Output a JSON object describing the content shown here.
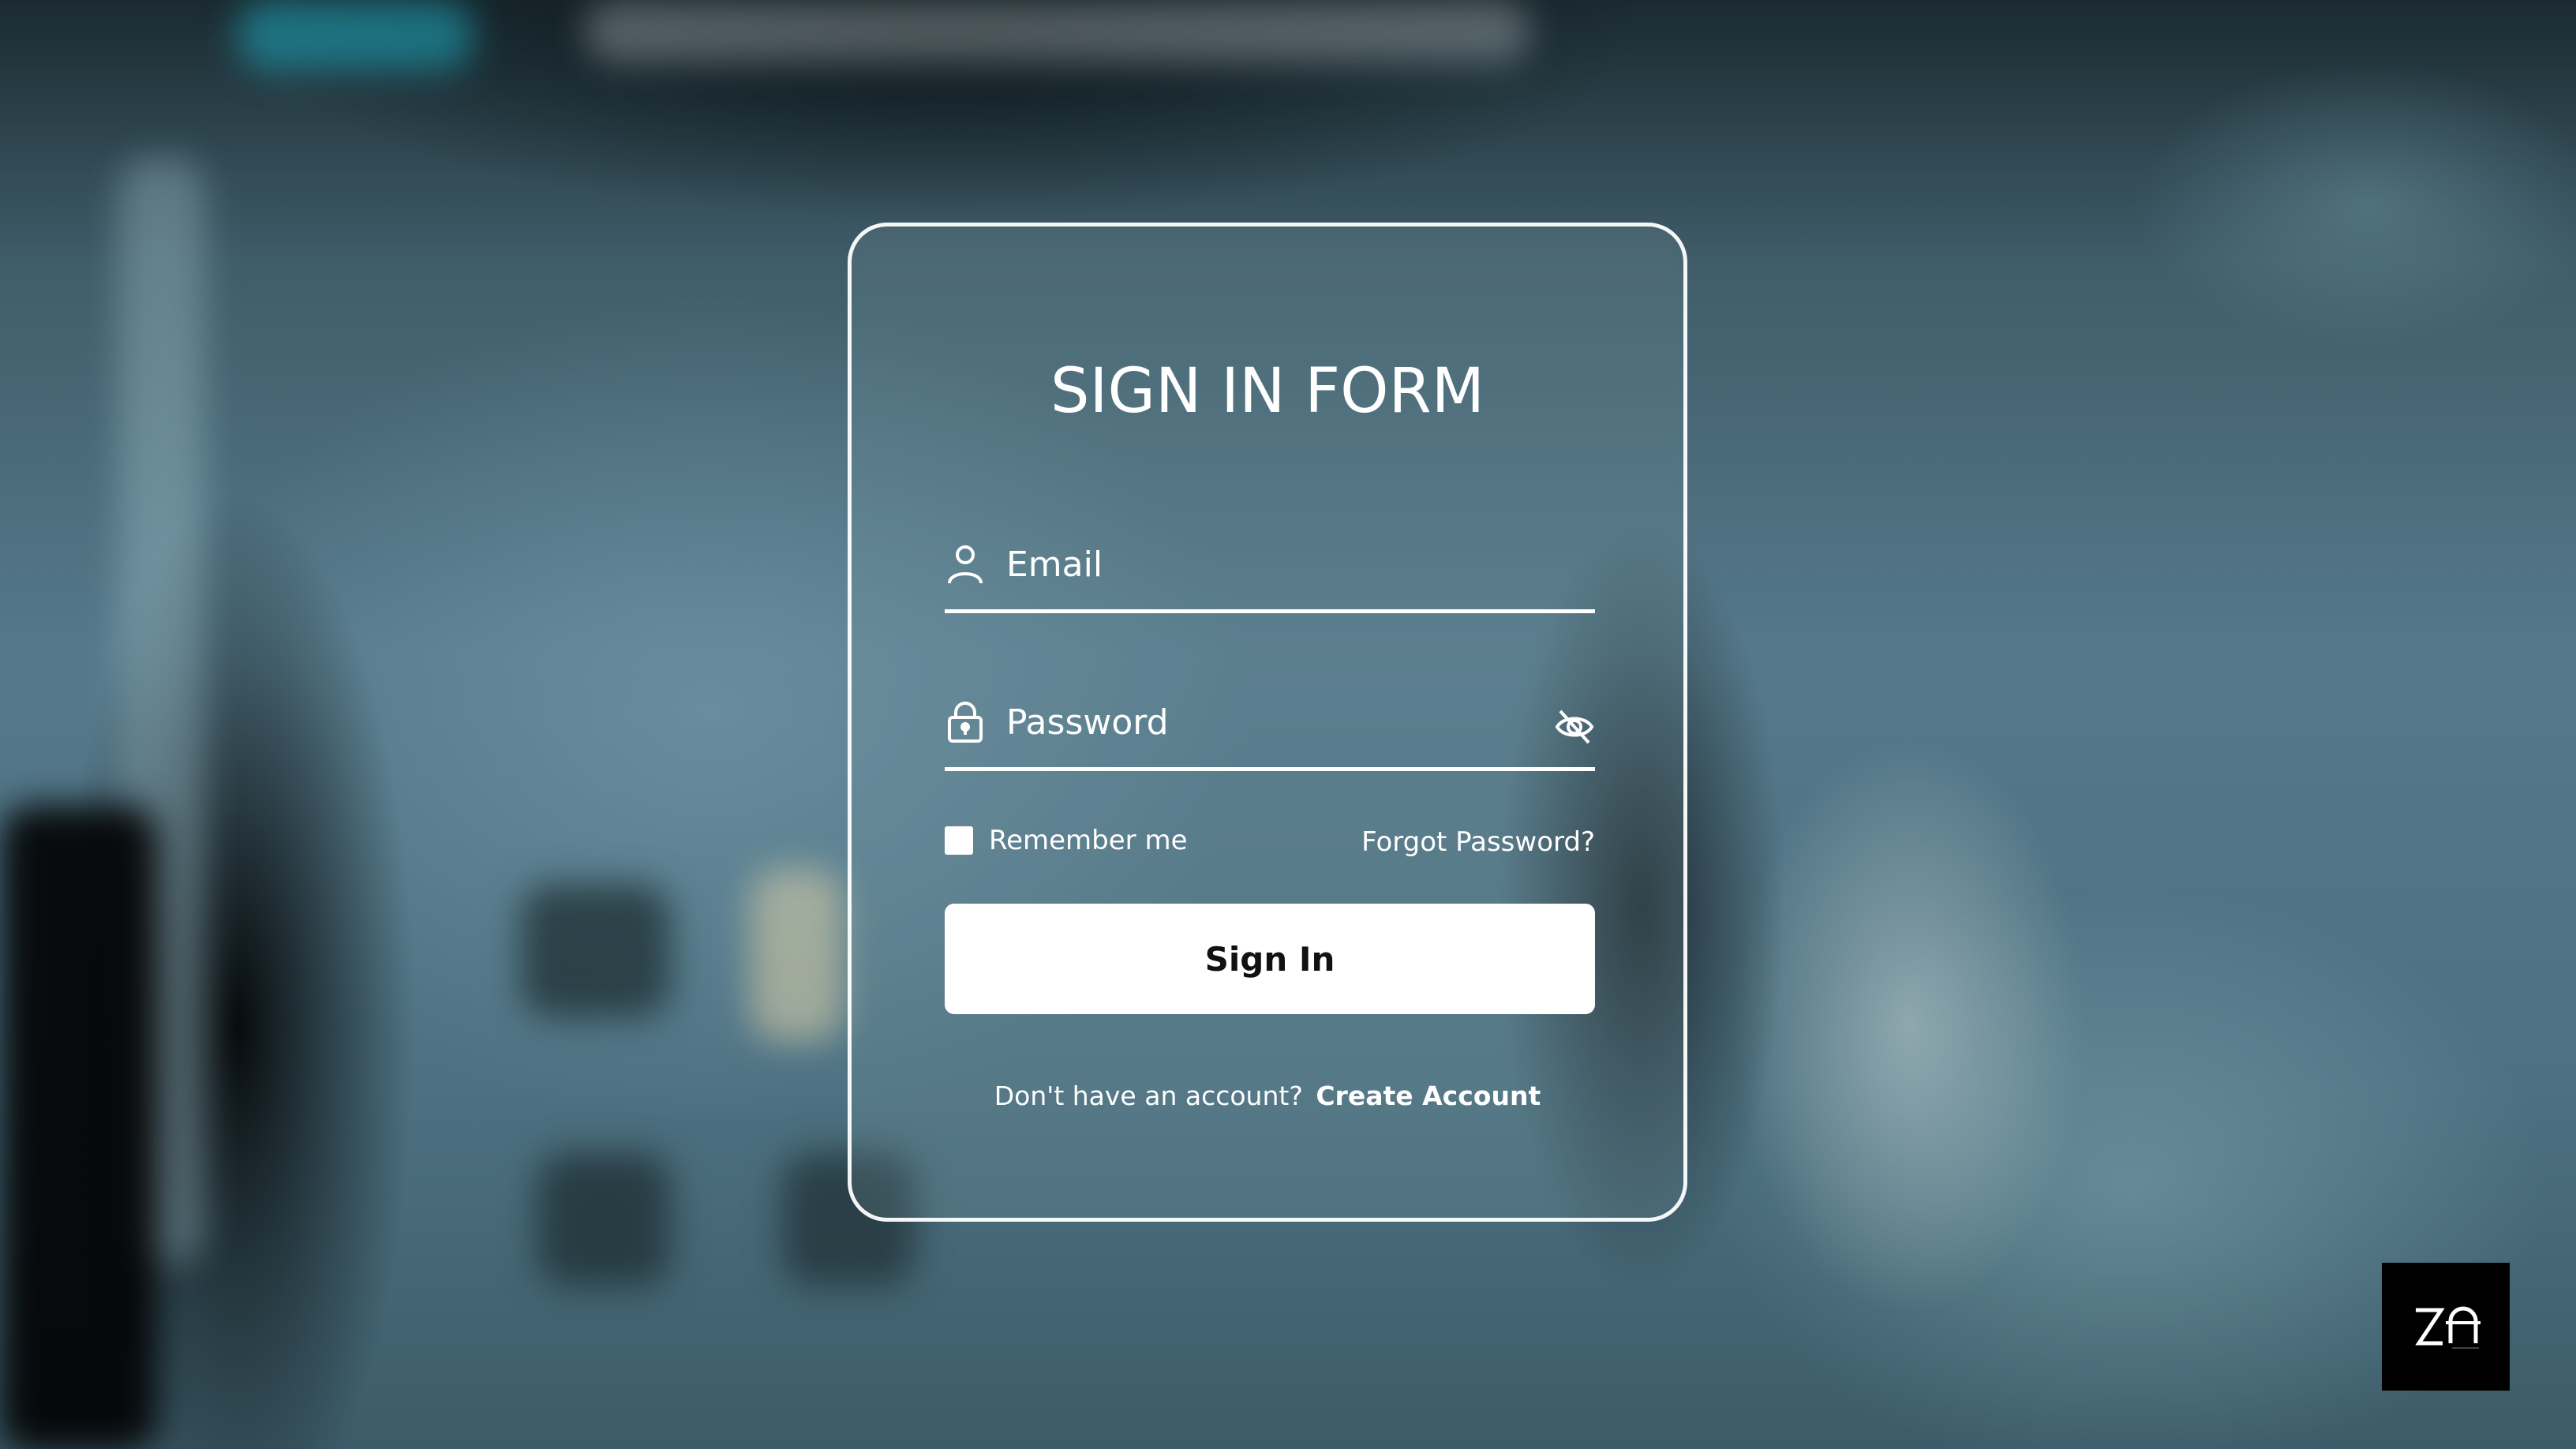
{
  "form": {
    "title": "SIGN IN FORM",
    "email": {
      "placeholder": "Email",
      "icon": "user-icon"
    },
    "password": {
      "placeholder": "Password",
      "icon": "lock-icon",
      "toggle_icon": "eye-off-icon"
    },
    "remember_label": "Remember me",
    "remember_checked": false,
    "forgot_label": "Forgot Password?",
    "submit_label": "Sign In",
    "footer_prompt": "Don't have an account?",
    "footer_link": "Create Account"
  },
  "brand": {
    "logo_text": "ZA",
    "logo_icon": "brand-logo"
  },
  "colors": {
    "card_border": "#ffffff",
    "button_bg": "#ffffff",
    "button_text": "#111111",
    "logo_bg": "#000000"
  }
}
